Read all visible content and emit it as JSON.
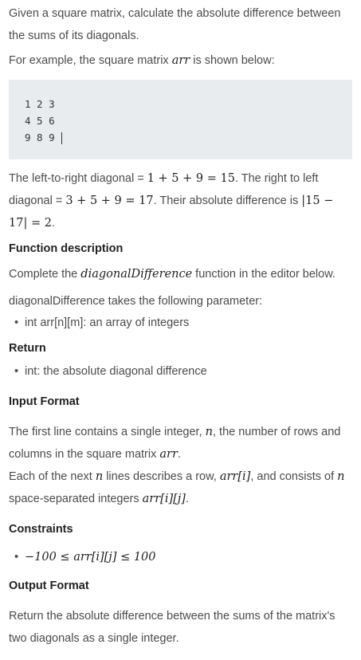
{
  "intro": {
    "line1": "Given a square matrix, calculate the absolute difference between the sums of its diagonals.",
    "example_prefix": "For example, the square matrix ",
    "example_var": "arr",
    "example_suffix": " is shown below:"
  },
  "matrix": {
    "rows": [
      "1 2 3",
      "4 5 6",
      "9 8 9"
    ]
  },
  "explanation": {
    "p1a": "The left-to-right diagonal = ",
    "m1": "1 + 5 + 9 = 15",
    "p1b": ". The right to left diagonal = ",
    "m2": "3 + 5 + 9 = 17",
    "p1c": ". Their absolute difference is ",
    "m3": "|15 − 17| = 2",
    "p1d": "."
  },
  "function_description": {
    "heading": "Function description",
    "p_prefix": "Complete the ",
    "fn_name": "diagonalDifference",
    "p_suffix": " function in the editor below.",
    "param_intro": "diagonalDifference takes the following parameter:",
    "params": [
      "int arr[n][m]: an array of integers"
    ]
  },
  "return_section": {
    "heading": "Return",
    "items": [
      "int: the absolute diagonal difference"
    ]
  },
  "input_format": {
    "heading": "Input Format",
    "l1a": "The first line contains a single integer, ",
    "l1m": "n",
    "l1b": ", the number of rows and columns in the square matrix ",
    "l1m2": "arr",
    "l1c": ".",
    "l2a": "Each of the next ",
    "l2m": "n",
    "l2b": " lines describes a row, ",
    "l2m2": "arr[i]",
    "l2c": ", and consists of ",
    "l3m": "n",
    "l3b": " space-separated integers ",
    "l3m2": "arr[i][j]",
    "l3c": "."
  },
  "constraints": {
    "heading": "Constraints",
    "item": "−100 ≤ arr[i][j] ≤ 100"
  },
  "output_format": {
    "heading": "Output Format",
    "text": "Return the absolute difference between the sums of the matrix's two diagonals as a single integer."
  }
}
